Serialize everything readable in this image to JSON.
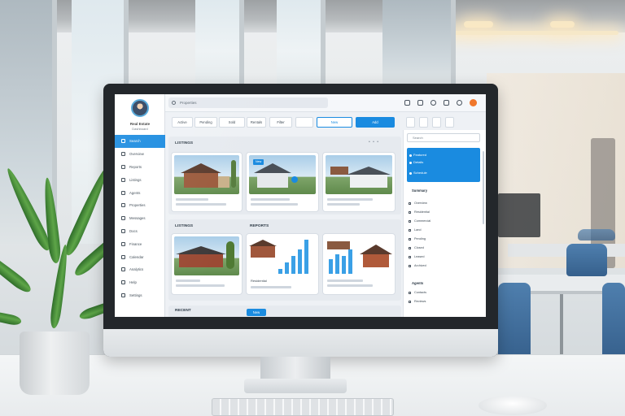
{
  "sidebar": {
    "profile_name": "Real Estate",
    "profile_sub": "Dashboard",
    "items": [
      {
        "label": "Search",
        "icon": "search-icon"
      },
      {
        "label": "Overview",
        "icon": "home-icon"
      },
      {
        "label": "Reports",
        "icon": "chart-icon"
      },
      {
        "label": "Listings",
        "icon": "list-icon"
      },
      {
        "label": "Agents",
        "icon": "user-icon"
      },
      {
        "label": "Properties",
        "icon": "building-icon"
      },
      {
        "label": "Messages",
        "icon": "mail-icon"
      },
      {
        "label": "Docs",
        "icon": "doc-icon"
      },
      {
        "label": "Finance",
        "icon": "money-icon"
      },
      {
        "label": "Calendar",
        "icon": "calendar-icon"
      },
      {
        "label": "Analytics",
        "icon": "analytics-icon"
      },
      {
        "label": "Help",
        "icon": "help-icon"
      },
      {
        "label": "Settings",
        "icon": "gear-icon"
      }
    ]
  },
  "topbar": {
    "search_text": "Properties"
  },
  "toolbar": {
    "buttons": [
      "Active",
      "Pending",
      "Sold",
      "Rentals",
      "Filter"
    ],
    "outline_button": "New",
    "primary_button": "Add"
  },
  "main": {
    "panel1_title": "LISTINGS",
    "panel2_title": "LISTINGS",
    "panel2b_title": "REPORTS",
    "panel3_title": "RECENT",
    "card_tag": "New",
    "card_caption": "Residential"
  },
  "rightpanel": {
    "search_placeholder": "Search",
    "card_lines": [
      "Featured",
      "Details",
      "Schedule"
    ],
    "head1": "Summary",
    "items1": [
      "Overview",
      "Residential",
      "Commercial",
      "Land",
      "Pending",
      "Closed",
      "Leased",
      "Archived"
    ],
    "head2": "Agents",
    "items2": [
      "Contacts",
      "Reviews"
    ]
  },
  "colors": {
    "accent": "#1a8be0",
    "sidebar_active": "#1a8be0",
    "bars": "#3aa0e6"
  }
}
